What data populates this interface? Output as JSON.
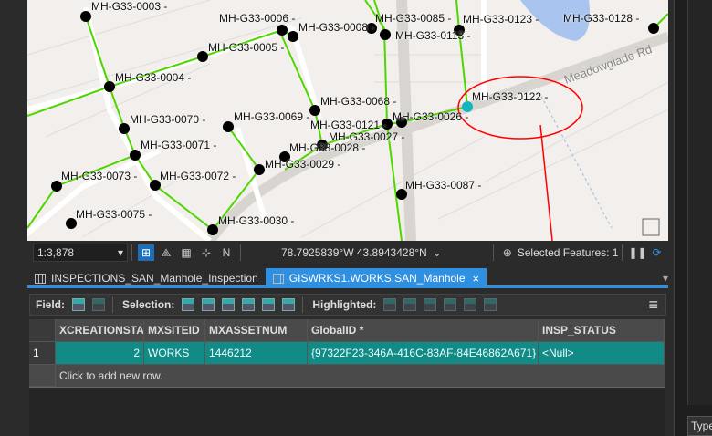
{
  "map": {
    "road_label": "Meadowglade Rd",
    "labels": [
      "MH-G33-0003 -",
      "MH-G33-0006 -",
      "MH-G33-0008 -",
      "MH-G33-0085 -",
      "MH-G33-0123 -",
      "MH-G33-0113 -",
      "MH-G33-0128 -",
      "MH-G33-0005 -",
      "MH-G33-0004 -",
      "MH-G33-0122 -",
      "MH-G33-0068 -",
      "MH-G33-0070 -",
      "MH-G33-0069 -",
      "MH-G33-0121 -",
      "MH-G33-0026 -",
      "MH-G33-0027 -",
      "MH-G33-0028 -",
      "MH-G33-0071 -",
      "MH-G33-0029 -",
      "MH-G33-0073 -",
      "MH-G33-0072 -",
      "MH-G33-0087 -",
      "MH-G33-0075 -",
      "MH-G33-0030 -"
    ],
    "selected_color": "#13b5c0",
    "annotation_color": "#ff0000"
  },
  "status": {
    "scale": "1:3,878",
    "coordinates": "78.7925839°W 43.8943428°N",
    "selected": "Selected Features: 1"
  },
  "tabs": [
    {
      "label": "INSPECTIONS_SAN_Manhole_Inspection"
    },
    {
      "label": "GISWRKS1.WORKS.SAN_Manhole",
      "close": "×"
    }
  ],
  "toolbar": {
    "field": "Field:",
    "selection": "Selection:",
    "highlighted": "Highlighted:",
    "menu": "≡"
  },
  "table": {
    "columns": [
      "XCREATIONSTATE",
      "MXSITEID",
      "MXASSETNUM",
      "GlobalID *",
      "INSP_STATUS"
    ],
    "rows": [
      {
        "num": "1",
        "cells": [
          "2",
          "WORKS",
          "1446212",
          "{97322F23-346A-416C-83AF-84E46862A671}",
          "<Null>"
        ]
      }
    ],
    "add_row": "Click to add new row."
  },
  "right_panel": {
    "type_label": "Type"
  }
}
